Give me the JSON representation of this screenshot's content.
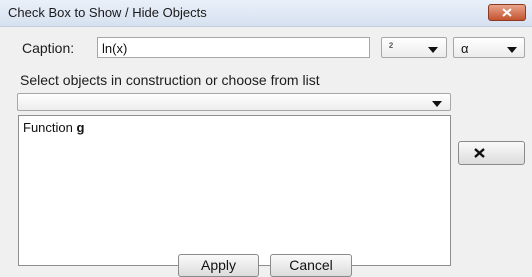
{
  "window": {
    "title": "Check Box to Show / Hide Objects",
    "close_icon": "close-x-icon"
  },
  "caption": {
    "label": "Caption:",
    "value": "ln(x)"
  },
  "symbol_dropdowns": [
    {
      "value": "²",
      "icon": "chevron-down-icon"
    },
    {
      "value": "α",
      "icon": "chevron-down-icon"
    }
  ],
  "instructions": "Select objects in construction or choose from list",
  "object_select": {
    "value": "",
    "icon": "chevron-down-icon"
  },
  "object_list": {
    "items": [
      {
        "prefix": "Function ",
        "name": "g"
      }
    ]
  },
  "remove_button": {
    "icon": "remove-x-icon"
  },
  "buttons": {
    "apply": "Apply",
    "cancel": "Cancel"
  },
  "colors": {
    "titlebar": "#dbe5f1",
    "close_button": "#c4542f",
    "dialog_bg": "#f0f0f0"
  }
}
